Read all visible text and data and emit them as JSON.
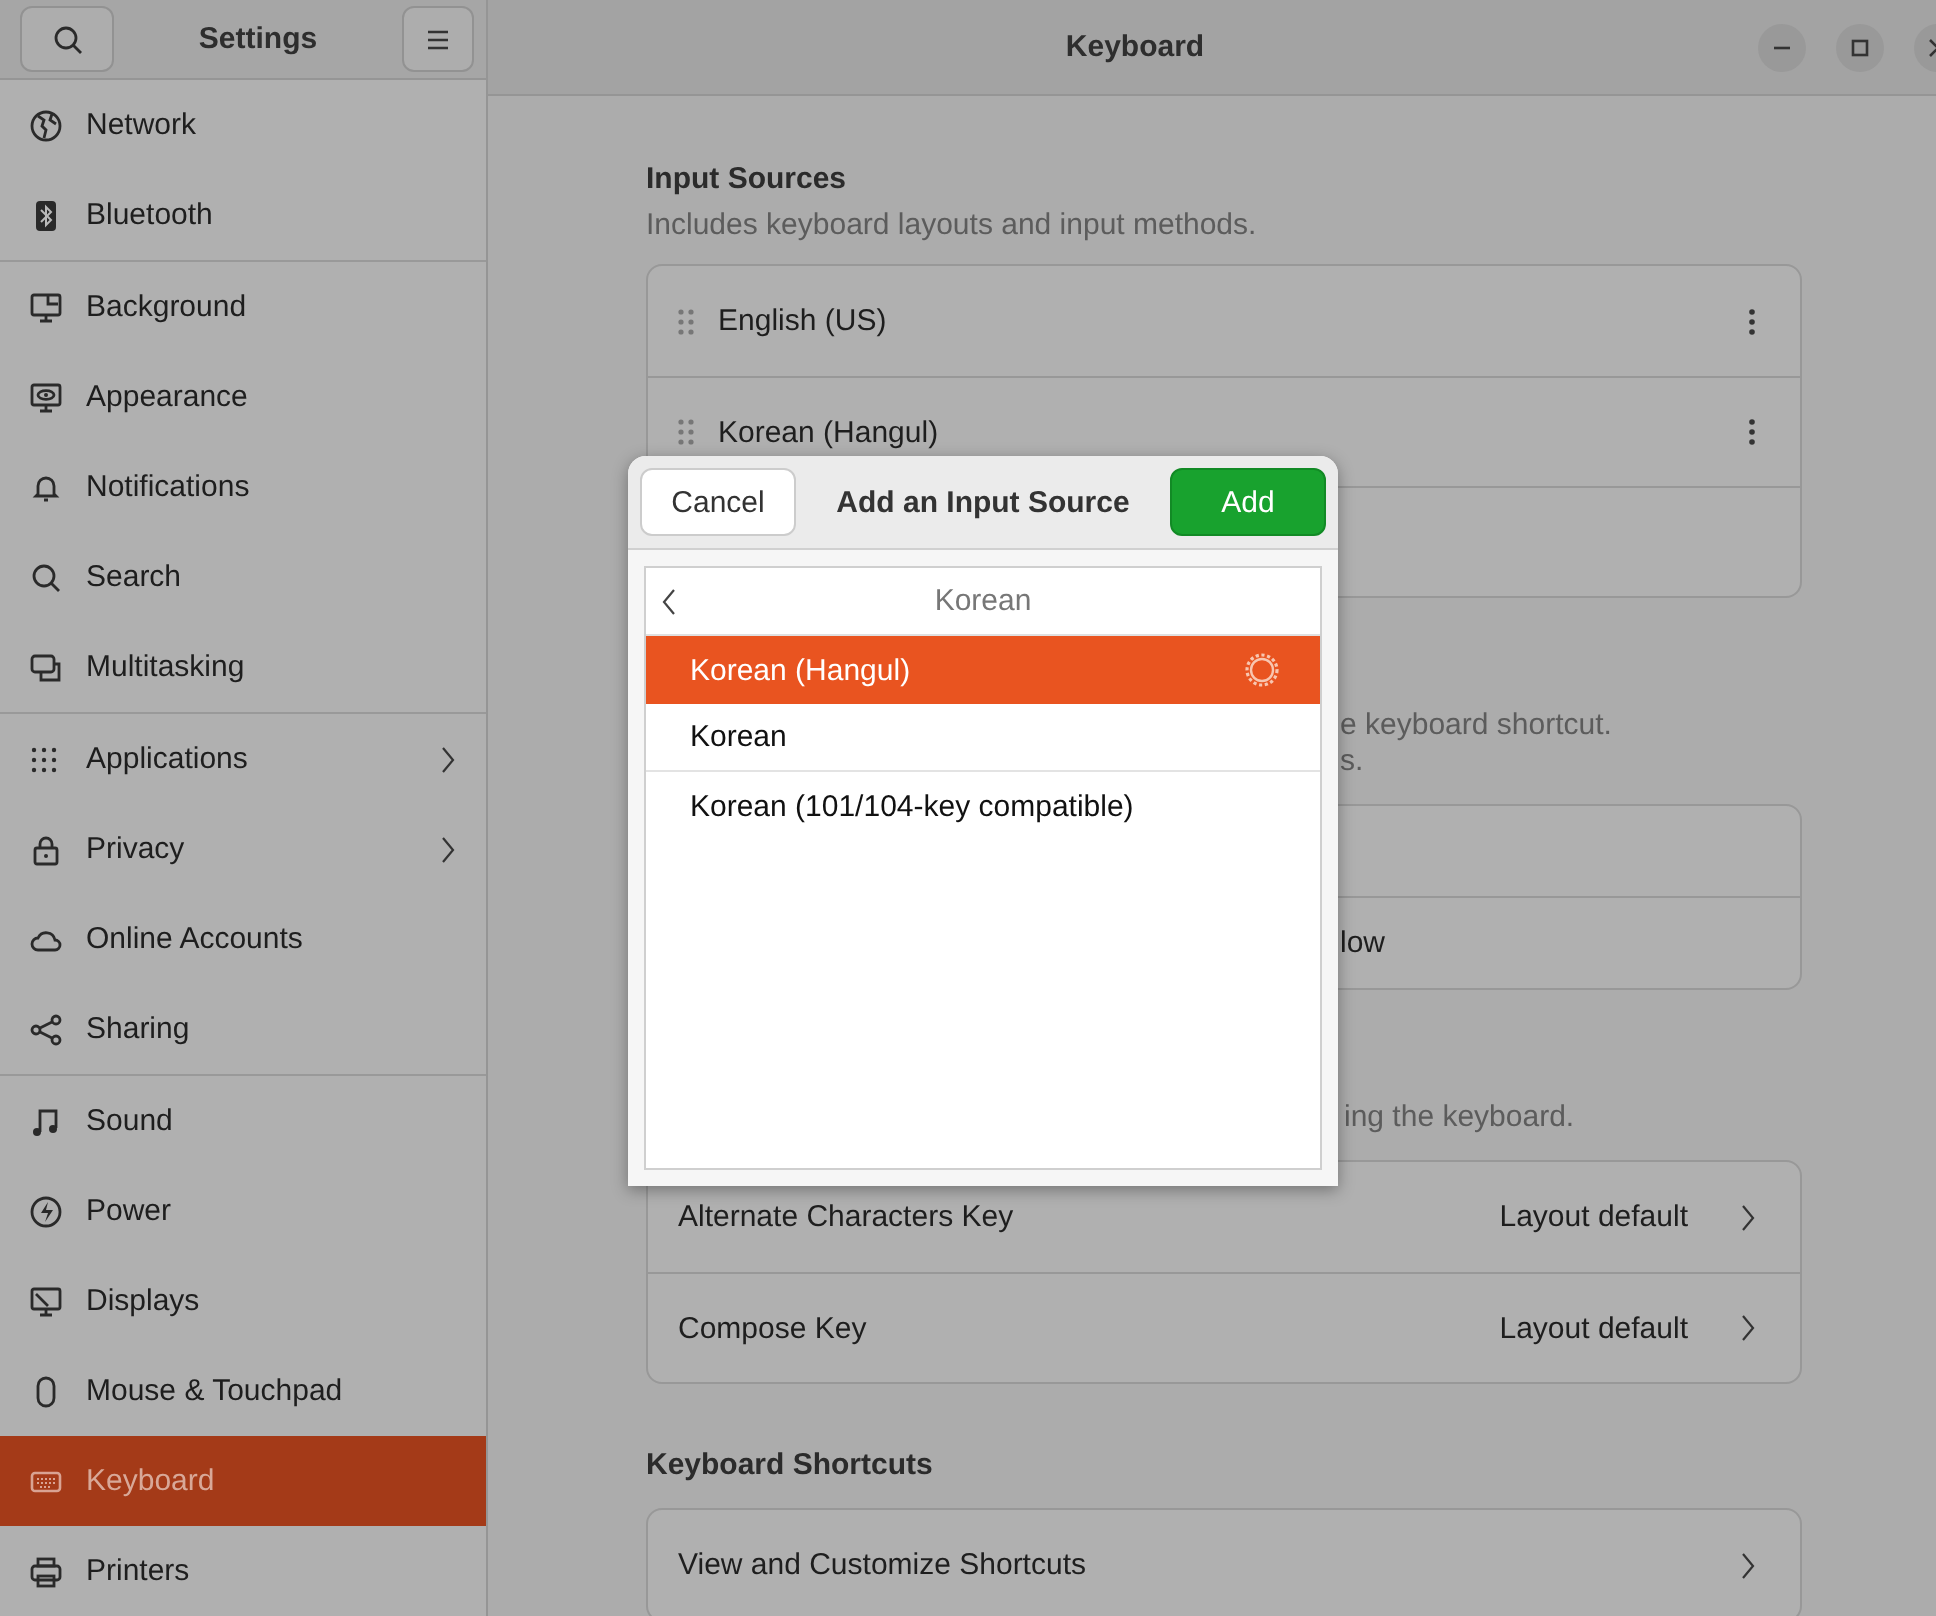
{
  "sidebar": {
    "title": "Settings",
    "groups": [
      [
        {
          "label": "Network",
          "selected": false,
          "has_submenu": false
        },
        {
          "label": "Bluetooth",
          "selected": false,
          "has_submenu": false
        }
      ],
      [
        {
          "label": "Background",
          "selected": false,
          "has_submenu": false
        },
        {
          "label": "Appearance",
          "selected": false,
          "has_submenu": false
        },
        {
          "label": "Notifications",
          "selected": false,
          "has_submenu": false
        },
        {
          "label": "Search",
          "selected": false,
          "has_submenu": false
        },
        {
          "label": "Multitasking",
          "selected": false,
          "has_submenu": false
        }
      ],
      [
        {
          "label": "Applications",
          "selected": false,
          "has_submenu": true
        },
        {
          "label": "Privacy",
          "selected": false,
          "has_submenu": true
        },
        {
          "label": "Online Accounts",
          "selected": false,
          "has_submenu": false
        },
        {
          "label": "Sharing",
          "selected": false,
          "has_submenu": false
        }
      ],
      [
        {
          "label": "Sound",
          "selected": false,
          "has_submenu": false
        },
        {
          "label": "Power",
          "selected": false,
          "has_submenu": false
        },
        {
          "label": "Displays",
          "selected": false,
          "has_submenu": false
        },
        {
          "label": "Mouse & Touchpad",
          "selected": false,
          "has_submenu": false
        },
        {
          "label": "Keyboard",
          "selected": true,
          "has_submenu": false
        },
        {
          "label": "Printers",
          "selected": false,
          "has_submenu": false
        }
      ]
    ]
  },
  "header": {
    "title": "Keyboard"
  },
  "input_sources": {
    "title": "Input Sources",
    "subtitle": "Includes keyboard layouts and input methods.",
    "rows": [
      {
        "kind": "source",
        "label": "English (US)"
      },
      {
        "kind": "source",
        "label": "Korean (Hangul)"
      },
      {
        "kind": "blank"
      }
    ]
  },
  "switching": {
    "description_lines": [
      "e keyboard shortcut.",
      "s."
    ],
    "rows": [
      {
        "kind": "blank"
      },
      {
        "kind": "fragment",
        "label": "low"
      }
    ]
  },
  "special_keys": {
    "description": "ing the keyboard.",
    "rows": [
      {
        "label": "Alternate Characters Key",
        "value": "Layout default"
      },
      {
        "label": "Compose Key",
        "value": "Layout default"
      }
    ]
  },
  "shortcuts": {
    "title": "Keyboard Shortcuts",
    "rows": [
      {
        "label": "View and Customize Shortcuts"
      }
    ]
  },
  "dialog": {
    "cancel": "Cancel",
    "title": "Add an Input Source",
    "add": "Add",
    "category": "Korean",
    "options": [
      {
        "label": "Korean (Hangul)",
        "selected": true
      },
      {
        "label": "Korean",
        "selected": false
      },
      {
        "label": "Korean (101/104-key compatible)",
        "selected": false
      }
    ]
  }
}
